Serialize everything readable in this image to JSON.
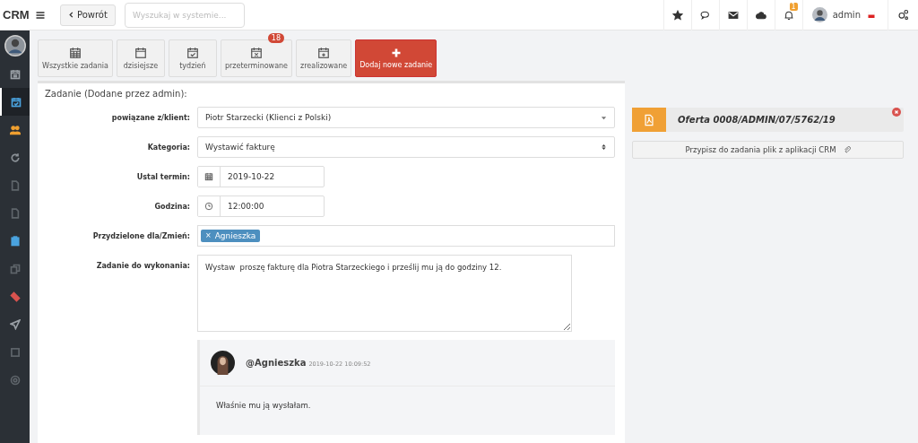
{
  "topbar": {
    "logo": "CRM",
    "back_button": "Powrót",
    "search": {
      "placeholder": "Wyszukaj w systemie..."
    },
    "icons": [
      {
        "kind": "star"
      },
      {
        "kind": "chat"
      },
      {
        "kind": "mail"
      },
      {
        "kind": "cloud"
      },
      {
        "kind": "bell",
        "badge": "1"
      }
    ],
    "user": "admin"
  },
  "sidebar": {
    "items": [
      {
        "kind": "calendar",
        "selected": false,
        "color": "#9aa0a6"
      },
      {
        "kind": "calendar-check",
        "selected": true,
        "color": "#4aa3df"
      },
      {
        "kind": "users",
        "selected": false,
        "color": "#f0a030"
      },
      {
        "kind": "refresh",
        "selected": false,
        "color": "#8a9096"
      },
      {
        "kind": "file",
        "selected": false,
        "color": "#5f656b"
      },
      {
        "kind": "file",
        "selected": false,
        "color": "#5f656b"
      },
      {
        "kind": "clipboard",
        "selected": false,
        "color": "#4aa3df"
      },
      {
        "kind": "copy",
        "selected": false,
        "color": "#5f656b"
      },
      {
        "kind": "ticket",
        "selected": false,
        "color": "#d9534f"
      },
      {
        "kind": "plane",
        "selected": false,
        "color": "#9aa0a6"
      },
      {
        "kind": "square",
        "selected": false,
        "color": "#5f656b"
      },
      {
        "kind": "at",
        "selected": false,
        "color": "#5f656b"
      }
    ]
  },
  "task_tabs": [
    {
      "label": "Wszystkie zadania",
      "kind": "all"
    },
    {
      "label": "dzisiejsze",
      "kind": "today"
    },
    {
      "label": "tydzień",
      "kind": "week"
    },
    {
      "label": "przeterminowane",
      "kind": "overdue",
      "badge": "18"
    },
    {
      "label": "zrealizowane",
      "kind": "done"
    },
    {
      "label": "Dodaj nowe zadanie",
      "kind": "add"
    }
  ],
  "form": {
    "title": "Zadanie (Dodane przez admin):",
    "fields": [
      {
        "label": "powiązane z/klient:",
        "kind": "dropdown",
        "value": "Piotr Starzecki (Klienci z Polski)"
      },
      {
        "label": "Kategoria:",
        "kind": "select",
        "value": "Wystawić fakturę"
      },
      {
        "label": "Ustal termin:",
        "kind": "date",
        "value": "2019-10-22"
      },
      {
        "label": "Godzina:",
        "kind": "time",
        "value": "12:00:00"
      },
      {
        "label": "Przydzielone dla/Zmień:",
        "kind": "tags",
        "tags": [
          {
            "remove": "×",
            "label": "Agnieszka"
          }
        ]
      },
      {
        "label": "Zadanie do wykonania:",
        "kind": "textarea",
        "value": "Wystaw  proszę fakturę dla Piotra Starzeckiego i prześlij mu ją do godziny 12."
      }
    ]
  },
  "comment": {
    "author": "@Agnieszka",
    "time": "2019-10-22 10:09:52",
    "text": "Właśnie mu ją wysłałam."
  },
  "attachment": {
    "title": "Oferta 0008/ADMIN/07/5762/19",
    "assign_button": "Przypisz do zadania plik z aplikacji CRM"
  }
}
